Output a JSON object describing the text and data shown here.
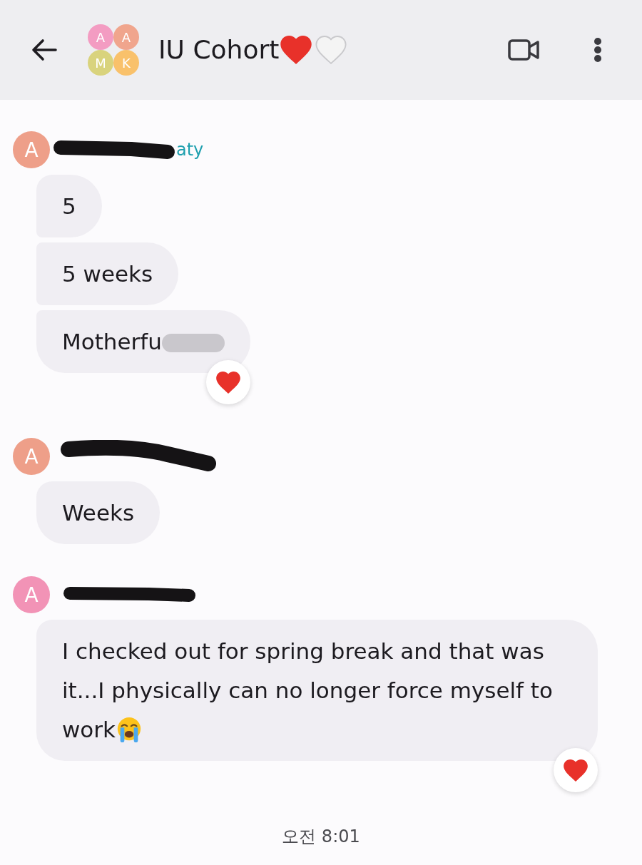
{
  "header": {
    "title": "IU Cohort",
    "group_avatar": [
      {
        "letter": "A",
        "color": "#f39cc2"
      },
      {
        "letter": "A",
        "color": "#f0a58d"
      },
      {
        "letter": "M",
        "color": "#d9d37d"
      },
      {
        "letter": "K",
        "color": "#f9c16b"
      }
    ]
  },
  "groups": [
    {
      "avatar": {
        "letter": "A",
        "color": "#ee9f89"
      },
      "sender": {
        "name": "aty",
        "color": "#1d9fae",
        "redacted": true
      },
      "messages": [
        {
          "text": "5",
          "smudged": false,
          "trailing_emoji": false,
          "reacted": false
        },
        {
          "text": "5 weeks",
          "smudged": false,
          "trailing_emoji": false,
          "reacted": false
        },
        {
          "text": "Motherfu",
          "smudged": true,
          "trailing_emoji": false,
          "reacted": true
        }
      ]
    },
    {
      "avatar": {
        "letter": "A",
        "color": "#ee9f89"
      },
      "sender": {
        "redacted": true
      },
      "messages": [
        {
          "text": "Weeks",
          "smudged": false,
          "trailing_emoji": false,
          "reacted": false
        }
      ]
    },
    {
      "avatar": {
        "letter": "A",
        "color": "#f293b6"
      },
      "sender": {
        "redacted": true
      },
      "messages": [
        {
          "text": "I checked out for spring break and that was it...I physically can no longer force myself to work",
          "smudged": false,
          "trailing_emoji": true,
          "reacted": true
        }
      ]
    }
  ],
  "timestamp": "오전 8:01"
}
